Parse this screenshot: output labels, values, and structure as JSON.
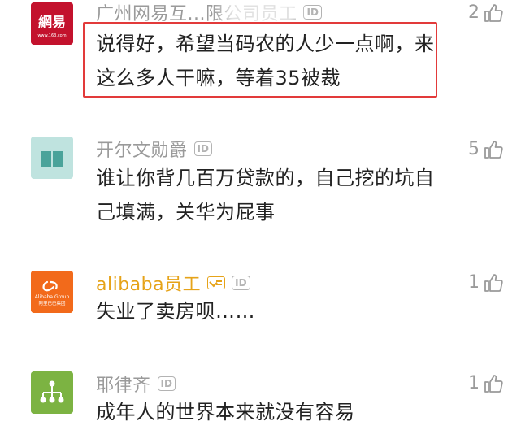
{
  "comments": [
    {
      "name": "广州网易互...限公司员工",
      "id_badge": "ID",
      "text": "说得好，希望当码农的人少一点啊，来这么多人干嘛，等着35被裁",
      "likes": "2",
      "avatar": {
        "kind": "netease-logo",
        "glyphs": "網易",
        "sub": "www.163.com",
        "bg": "#c3122d"
      }
    },
    {
      "name": "开尔文勋爵",
      "id_badge": "ID",
      "text": "谁让你背几百万贷款的，自己挖的坑自己填满，关华为屁事",
      "likes": "5",
      "avatar": {
        "kind": "book-icon",
        "bg": "#bfe3df"
      }
    },
    {
      "name": "alibaba员工",
      "id_badge": "ID",
      "text": "失业了卖房呗……",
      "likes": "1",
      "avatar": {
        "kind": "alibaba-logo",
        "label": "Alibaba Group",
        "cn": "阿里巴巴集团",
        "bg": "#f26a1b"
      }
    },
    {
      "name": "耶律齐",
      "id_badge": "ID",
      "text": "成年人的世界本来就没有容易",
      "likes": "1",
      "avatar": {
        "kind": "hierarchy-icon",
        "bg": "#7cb342"
      }
    }
  ],
  "colors": {
    "name_gray": "#9a9a9a",
    "name_vip": "#e6a319",
    "highlight_border": "#e23a3a",
    "text": "#222222"
  }
}
